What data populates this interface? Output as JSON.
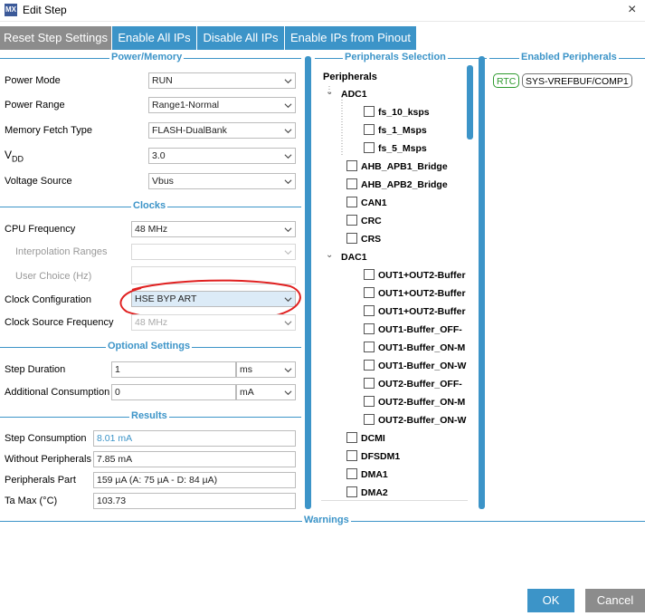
{
  "window": {
    "icon": "MX",
    "title": "Edit Step",
    "close": "×"
  },
  "toolbar": {
    "reset": "Reset Step Settings",
    "enable_all": "Enable All IPs",
    "disable_all": "Disable All IPs",
    "enable_pinout": "Enable IPs from Pinout"
  },
  "power_memory": {
    "header": "Power/Memory",
    "power_mode": {
      "label": "Power Mode",
      "value": "RUN"
    },
    "power_range": {
      "label": "Power Range",
      "value": "Range1-Normal"
    },
    "memory_fetch": {
      "label": "Memory Fetch Type",
      "value": "FLASH-DualBank"
    },
    "vdd": {
      "label": "V",
      "label_sub": "DD",
      "value": "3.0"
    },
    "voltage_source": {
      "label": "Voltage Source",
      "value": "Vbus"
    }
  },
  "clocks": {
    "header": "Clocks",
    "cpu_freq": {
      "label": "CPU Frequency",
      "value": "48 MHz"
    },
    "interp": {
      "label": "Interpolation Ranges",
      "value": ""
    },
    "user_choice": {
      "label": "User Choice (Hz)",
      "value": ""
    },
    "clock_config": {
      "label": "Clock Configuration",
      "value": "HSE BYP ART"
    },
    "clock_source": {
      "label": "Clock Source Frequency",
      "value": "48 MHz"
    }
  },
  "optional": {
    "header": "Optional Settings",
    "step_duration": {
      "label": "Step Duration",
      "value": "1",
      "unit": "ms"
    },
    "additional": {
      "label": "Additional Consumption",
      "value": "0",
      "unit": "mA"
    }
  },
  "results": {
    "header": "Results",
    "step_consumption": {
      "label": "Step Consumption",
      "value": "8.01 mA"
    },
    "without_periph": {
      "label": "Without Peripherals",
      "value": "7.85 mA"
    },
    "periph_part": {
      "label": "Peripherals Part",
      "value": "159 µA  (A: 75 µA - D: 84 µA)"
    },
    "ta_max": {
      "label": "Ta Max (°C)",
      "value": "103.73"
    }
  },
  "peripherals": {
    "header": "Peripherals Selection",
    "root": "Peripherals",
    "adc1": "ADC1",
    "adc1_children": [
      "fs_10_ksps",
      "fs_1_Msps",
      "fs_5_Msps"
    ],
    "items_a": [
      "AHB_APB1_Bridge",
      "AHB_APB2_Bridge",
      "CAN1",
      "CRC",
      "CRS"
    ],
    "dac1": "DAC1",
    "dac1_children": [
      "OUT1+OUT2-Buffer",
      "OUT1+OUT2-Buffer",
      "OUT1+OUT2-Buffer",
      "OUT1-Buffer_OFF-",
      "OUT1-Buffer_ON-M",
      "OUT1-Buffer_ON-W",
      "OUT2-Buffer_OFF-",
      "OUT2-Buffer_ON-M",
      "OUT2-Buffer_ON-W"
    ],
    "items_b": [
      "DCMI",
      "DFSDM1",
      "DMA1",
      "DMA2"
    ]
  },
  "enabled": {
    "header": "Enabled Peripherals",
    "items": [
      "RTC",
      "SYS-VREFBUF/COMP1"
    ]
  },
  "warnings": {
    "header": "Warnings"
  },
  "buttons": {
    "ok": "OK",
    "cancel": "Cancel"
  },
  "colors": {
    "accent": "#3c94c8",
    "disabled_button": "#8c8c8c",
    "annotation": "#e02020",
    "rtc_badge": "#2e9a2e"
  }
}
